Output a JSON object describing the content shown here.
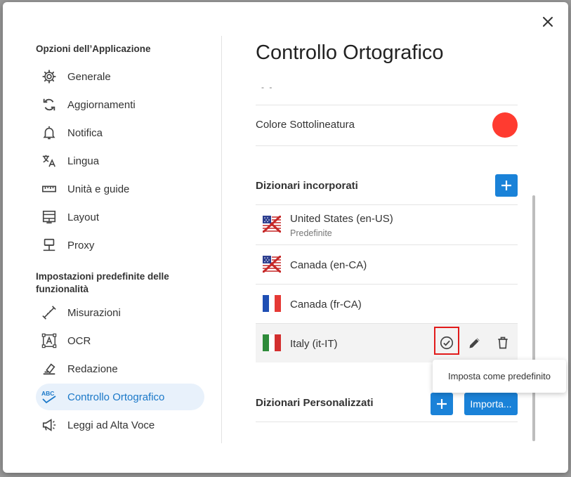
{
  "dialog": {
    "close_label": "×"
  },
  "sidebar": {
    "section1_title": "Opzioni dell’Applicazione",
    "section2_title": "Impostazioni predefinite delle funzionalità",
    "items": [
      {
        "label": "Generale",
        "icon": "gear-icon"
      },
      {
        "label": "Aggiornamenti",
        "icon": "sync-icon"
      },
      {
        "label": "Notifica",
        "icon": "bell-icon"
      },
      {
        "label": "Lingua",
        "icon": "translate-icon"
      },
      {
        "label": "Unità e guide",
        "icon": "ruler-icon"
      },
      {
        "label": "Layout",
        "icon": "layout-icon"
      },
      {
        "label": "Proxy",
        "icon": "proxy-icon"
      },
      {
        "label": "Misurazioni",
        "icon": "measure-icon"
      },
      {
        "label": "OCR",
        "icon": "ocr-icon"
      },
      {
        "label": "Redazione",
        "icon": "eraser-icon"
      },
      {
        "label": "Controllo Ortografico",
        "icon": "abc-check-icon",
        "active": true
      },
      {
        "label": "Leggi ad Alta Voce",
        "icon": "megaphone-icon"
      }
    ],
    "abc_text": "ABC"
  },
  "main": {
    "title": "Controllo Ortografico",
    "clipped_text": "- -",
    "underline_color_label": "Colore Sottolineatura",
    "underline_color": "#ff3b30",
    "builtin_dicts_title": "Dizionari incorporati",
    "dictionaries": [
      {
        "name": "United States (en-US)",
        "sub": "Predefinite",
        "flag": "us-uk-flag"
      },
      {
        "name": "Canada (en-CA)",
        "sub": "",
        "flag": "us-uk-flag"
      },
      {
        "name": "Canada (fr-CA)",
        "sub": "",
        "flag": "france-flag"
      },
      {
        "name": "Italy (it-IT)",
        "sub": "",
        "flag": "italy-flag"
      }
    ],
    "custom_dicts_title": "Dizionari Personalizzati",
    "import_label": "Importa...",
    "tooltip": "Imposta come predefinito"
  },
  "colors": {
    "accent": "#1a82d8",
    "active_bg": "#e8f1fb",
    "highlight": "#e21b1b"
  }
}
